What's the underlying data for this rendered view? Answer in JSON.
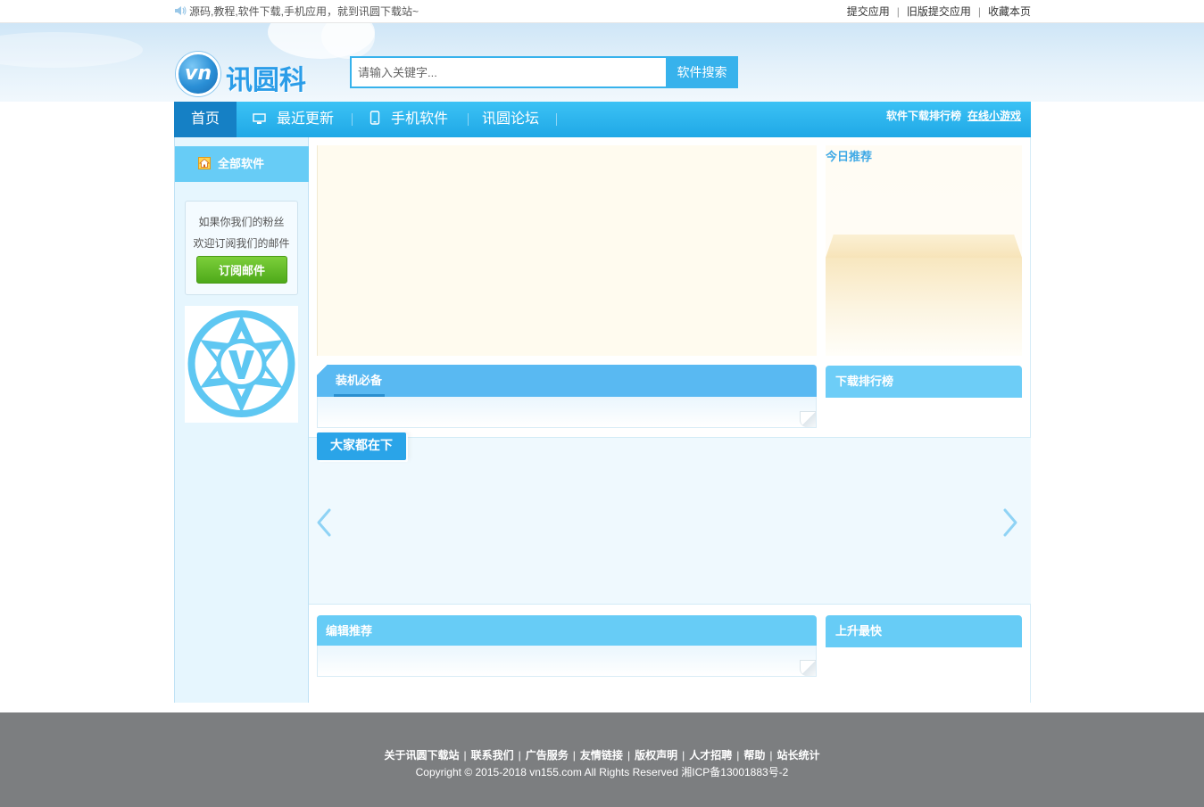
{
  "topbar": {
    "tagline": "源码,教程,软件下载,手机应用，就到讯圆下载站~",
    "links": [
      "提交应用",
      "旧版提交应用",
      "收藏本页"
    ]
  },
  "header": {
    "logo_mark": "vn",
    "logo_text": "讯圆科技",
    "search_placeholder": "请输入关键字...",
    "search_button": "软件搜索"
  },
  "nav": {
    "items": [
      "首页",
      "最近更新",
      "手机软件",
      "讯圆论坛"
    ],
    "right_links": [
      "软件下载排行榜",
      "在线小游戏"
    ],
    "colors": {
      "bar": "#1fa8e6",
      "active": "#1580c5"
    }
  },
  "sidebar": {
    "heading": "全部软件",
    "subscribe_line1": "如果你我们的粉丝",
    "subscribe_line2": "欢迎订阅我们的邮件",
    "subscribe_button": "订阅邮件"
  },
  "content": {
    "today_title": "今日推荐",
    "install_title": "装机必备",
    "rank_title": "下载排行榜",
    "everyone_title": "大家都在下",
    "editor_title": "编辑推荐",
    "rise_title": "上升最快"
  },
  "footer": {
    "links": [
      "关于讯圆下载站",
      "联系我们",
      "广告服务",
      "友情链接",
      "版权声明",
      "人才招聘",
      "帮助",
      "站长统计"
    ],
    "copyright": "Copyright © 2015-2018 vn155.com All Rights Reserved 湘ICP备13001883号-2"
  }
}
